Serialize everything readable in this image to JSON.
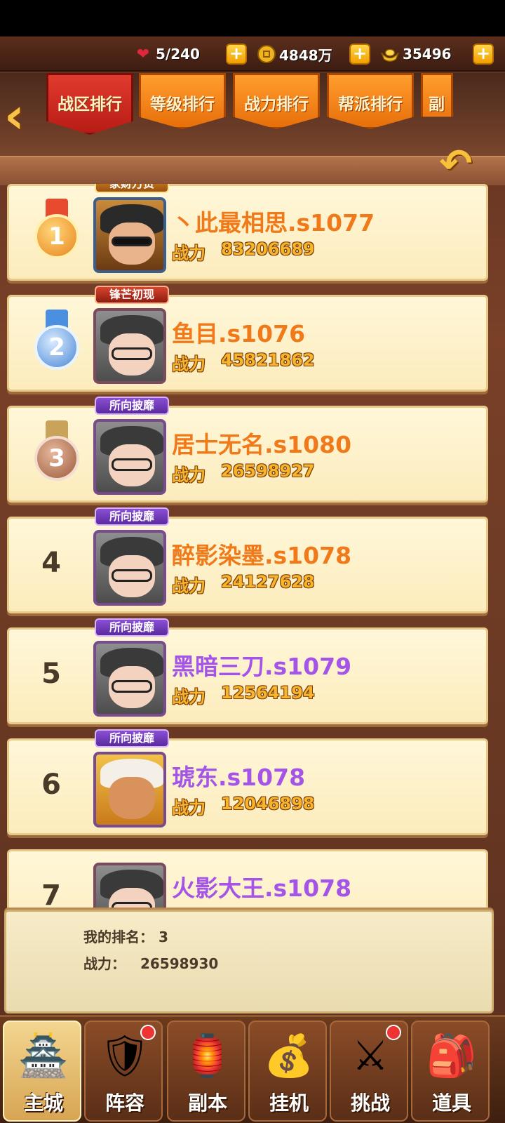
{
  "resources": {
    "stamina": {
      "icon": "heart-icon",
      "value": "5/240"
    },
    "coins": {
      "icon": "coin-icon",
      "value": "4848万"
    },
    "ingots": {
      "icon": "gold-ingot-icon",
      "value": "35496"
    }
  },
  "tabs": [
    {
      "label": "战区排行",
      "active": true
    },
    {
      "label": "等级排行",
      "active": false
    },
    {
      "label": "战力排行",
      "active": false
    },
    {
      "label": "帮派排行",
      "active": false
    },
    {
      "label": "副",
      "active": false
    }
  ],
  "power_label": "战力",
  "rankings": [
    {
      "rank": "1",
      "badge": "家财万贯",
      "name": "丶此最相思.s1077",
      "power": "83206689",
      "name_color": "#f07a1a"
    },
    {
      "rank": "2",
      "badge": "锋芒初现",
      "name": "鱼目.s1076",
      "power": "45821862",
      "name_color": "#f07a1a"
    },
    {
      "rank": "3",
      "badge": "所向披靡",
      "name": "居士无名.s1080",
      "power": "26598927",
      "name_color": "#f07a1a"
    },
    {
      "rank": "4",
      "badge": "所向披靡",
      "name": "醉影染墨.s1078",
      "power": "24127628",
      "name_color": "#f07a1a"
    },
    {
      "rank": "5",
      "badge": "所向披靡",
      "name": "黑暗三刀.s1079",
      "power": "12564194",
      "name_color": "#a455e8"
    },
    {
      "rank": "6",
      "badge": "所向披靡",
      "name": "琥东.s1078",
      "power": "12046898",
      "name_color": "#a455e8"
    },
    {
      "rank": "7",
      "badge": "",
      "name": "火影大王.s1078",
      "power": "",
      "name_color": "#a455e8"
    }
  ],
  "my_rank": {
    "rank_label": "我的排名：",
    "rank_value": "3",
    "power_label": "战力：",
    "power_value": "26598930"
  },
  "nav": [
    {
      "label": "主城",
      "icon": "city-gate-icon",
      "active": true,
      "dot": false
    },
    {
      "label": "阵容",
      "icon": "formation-icon",
      "active": false,
      "dot": true
    },
    {
      "label": "副本",
      "icon": "dungeon-icon",
      "active": false,
      "dot": false
    },
    {
      "label": "挂机",
      "icon": "idle-loot-icon",
      "active": false,
      "dot": false
    },
    {
      "label": "挑战",
      "icon": "challenge-icon",
      "active": false,
      "dot": true
    },
    {
      "label": "道具",
      "icon": "items-bag-icon",
      "active": false,
      "dot": false
    }
  ]
}
